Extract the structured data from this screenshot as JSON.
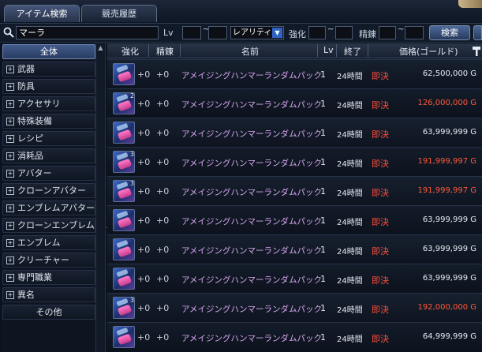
{
  "tabs": [
    {
      "label": "アイテム検索",
      "active": true
    },
    {
      "label": "競売履歴",
      "active": false
    }
  ],
  "search": {
    "query": "マーラ",
    "level_label": "Lv",
    "rarity_value": "レアリティー",
    "enhance_label": "強化",
    "refine_label": "精錬",
    "search_button": "検索"
  },
  "sidebar": {
    "items": [
      {
        "label": "全体",
        "expandable": false,
        "active": true
      },
      {
        "label": "武器",
        "expandable": true
      },
      {
        "label": "防具",
        "expandable": true
      },
      {
        "label": "アクセサリ",
        "expandable": true
      },
      {
        "label": "特殊装備",
        "expandable": true
      },
      {
        "label": "レシピ",
        "expandable": true
      },
      {
        "label": "消耗品",
        "expandable": true
      },
      {
        "label": "アバター",
        "expandable": true
      },
      {
        "label": "クローンアバター",
        "expandable": true
      },
      {
        "label": "エンブレムアバター",
        "expandable": true
      },
      {
        "label": "クローンエンブレムア...",
        "expandable": true
      },
      {
        "label": "エンブレム",
        "expandable": true
      },
      {
        "label": "クリーチャー",
        "expandable": true
      },
      {
        "label": "専門職業",
        "expandable": true
      },
      {
        "label": "異名",
        "expandable": true
      },
      {
        "label": "その他",
        "expandable": false
      }
    ]
  },
  "table": {
    "columns": {
      "enhance": "強化",
      "refine": "精錬",
      "name": "名前",
      "level": "Lv",
      "end": "終了",
      "price": "価格(ゴールド)"
    },
    "rows": [
      {
        "count": "",
        "enhance": "+0",
        "refine": "+0",
        "name": "アメイジングハンマーランダムパック",
        "level": "1",
        "end": "24時間",
        "bid": "即決",
        "price": "62,500,000 G",
        "price_color": "white"
      },
      {
        "count": "2",
        "enhance": "+0",
        "refine": "+0",
        "name": "アメイジングハンマーランダムパック",
        "level": "1",
        "end": "24時間",
        "bid": "即決",
        "price": "126,000,000 G",
        "price_color": "red"
      },
      {
        "count": "",
        "enhance": "+0",
        "refine": "+0",
        "name": "アメイジングハンマーランダムパック",
        "level": "1",
        "end": "24時間",
        "bid": "即決",
        "price": "63,999,999 G",
        "price_color": "white"
      },
      {
        "count": "3",
        "enhance": "+0",
        "refine": "+0",
        "name": "アメイジングハンマーランダムパック",
        "level": "1",
        "end": "24時間",
        "bid": "即決",
        "price": "191,999,997 G",
        "price_color": "red"
      },
      {
        "count": "3",
        "enhance": "+0",
        "refine": "+0",
        "name": "アメイジングハンマーランダムパック",
        "level": "1",
        "end": "24時間",
        "bid": "即決",
        "price": "191,999,997 G",
        "price_color": "red"
      },
      {
        "count": "",
        "enhance": "+0",
        "refine": "+0",
        "name": "アメイジングハンマーランダムパック",
        "level": "1",
        "end": "24時間",
        "bid": "即決",
        "price": "63,999,999 G",
        "price_color": "white"
      },
      {
        "count": "",
        "enhance": "+0",
        "refine": "+0",
        "name": "アメイジングハンマーランダムパック",
        "level": "1",
        "end": "24時間",
        "bid": "即決",
        "price": "63,999,999 G",
        "price_color": "white"
      },
      {
        "count": "",
        "enhance": "+0",
        "refine": "+0",
        "name": "アメイジングハンマーランダムパック",
        "level": "1",
        "end": "24時間",
        "bid": "即決",
        "price": "63,999,999 G",
        "price_color": "white"
      },
      {
        "count": "3",
        "enhance": "+0",
        "refine": "+0",
        "name": "アメイジングハンマーランダムパック",
        "level": "1",
        "end": "24時間",
        "bid": "即決",
        "price": "192,000,000 G",
        "price_color": "red"
      },
      {
        "count": "",
        "enhance": "+0",
        "refine": "+0",
        "name": "アメイジングハンマーランダムパック",
        "level": "1",
        "end": "24時間",
        "bid": "即決",
        "price": "64,999,999 G",
        "price_color": "white"
      }
    ]
  },
  "colors": {
    "price_white": "#e7ebf2",
    "price_red": "#ff5a3a",
    "bid": "#ff4e3c",
    "item_name": "#d7a8f0"
  }
}
